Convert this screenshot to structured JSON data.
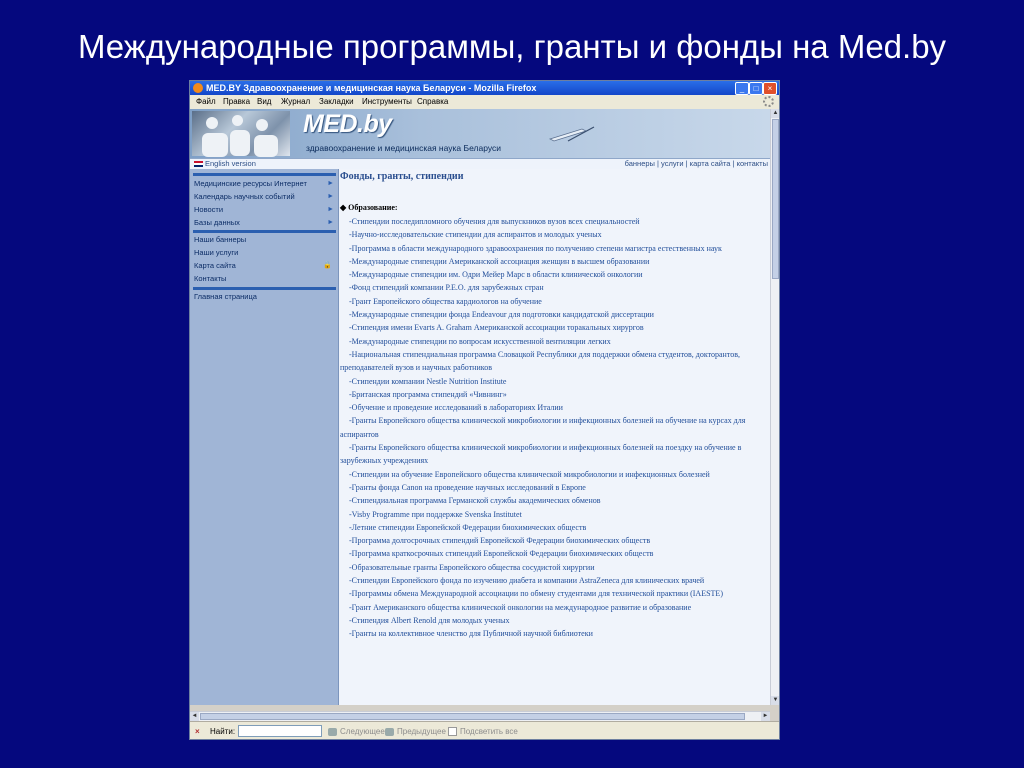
{
  "slide": {
    "title": "Международные программы, гранты и фонды на Med.by"
  },
  "window": {
    "title": "MED.BY Здравоохранение и медицинская наука Беларуси - Mozilla Firefox",
    "controls": [
      "_",
      "□",
      "×"
    ]
  },
  "menu": [
    "Файл",
    "Правка",
    "Вид",
    "Журнал",
    "Закладки",
    "Инструменты",
    "Справка"
  ],
  "banner": {
    "logo": "MED.by",
    "subtitle": "здравоохранение и медицинская наука Беларуси"
  },
  "topbar": {
    "english": "English version",
    "links": "баннеры | услуги | карта сайта | контакты"
  },
  "sidebar": {
    "group1": [
      {
        "label": "Медицинские ресурсы Интернет",
        "arrow": "►"
      },
      {
        "label": "Календарь научных событий",
        "arrow": "►"
      },
      {
        "label": "Новости",
        "arrow": "►"
      },
      {
        "label": "Базы данных",
        "arrow": "►"
      }
    ],
    "group2": [
      {
        "label": "Наши баннеры"
      },
      {
        "label": "Наши услуги"
      },
      {
        "label": "Карта сайта",
        "badge": "🔒"
      },
      {
        "label": "Контакты"
      }
    ],
    "group3": [
      {
        "label": "Главная страница"
      }
    ]
  },
  "content": {
    "title": "Фонды, гранты, стипендии",
    "section": "Образование:",
    "items": [
      "-Стипендии последипломного обучения для выпускников вузов всех специальностей",
      "-Научно-исследовательские стипендии для аспирантов и молодых ученых",
      "-Программа в области международного здравоохранения по получению степени магистра естественных наук",
      "-Международные стипендии Американской ассоциация женщин в высшем образовании",
      "-Международные стипендии им. Одри Мейер Марс в области клинической онкологии",
      "-Фонд стипендий компании P.E.O. для зарубежных стран",
      "-Грант Европейского общества кардиологов на обучение",
      "-Международные стипендии фонда Endeavour для подготовки кандидатской диссертации",
      "-Стипендия имени Evarts A. Graham Американской ассоциации торакальных хирургов",
      "-Международные стипендии по вопросам искусственной вентиляции легких",
      "-Национальная стипендиальная программа Словацкой Республики для поддержки обмена студентов, докторантов, преподавателей вузов и научных работников",
      "-Стипендии компании Nestle Nutrition Institute",
      "-Британская программа стипендий «Чивнинг»",
      "-Обучение и проведение исследований в лабораториях Италии",
      "-Гранты Европейского общества клинической микробиологии и инфекционных болезней на обучение на курсах для аспирантов",
      "-Гранты Европейского общества клинической микробиологии и инфекционных болезней на поездку на обучение в зарубежных учреждениях",
      "-Стипендии на обучение Европейского общества клинической микробиологии и инфекционных болезней",
      "-Гранты фонда Canon на проведение научных исследований в Европе",
      "-Стипендиальная программа Германской службы академических обменов",
      "-Visby Programme при поддержке Svenska Institutet",
      "-Летние стипендии Европейской Федерации биохимических обществ",
      "-Программа долгосрочных стипендий Европейской Федерации биохимических обществ",
      "-Программа краткосрочных стипендий Европейской Федерации биохимических обществ",
      "-Образовательные гранты Европейского общества сосудистой хирургии",
      "-Стипендии Европейского фонда по изучению диабета и компании AstraZeneca для клинических врачей",
      "-Программы обмена Международной ассоциации по обмену студентами для технической практики (IAESTE)",
      "-Грант Американского общества клинической онкологии на международное развитие и образование",
      "-Стипендия Albert Renold для молодых ученых",
      "-Гранты на коллективное членство для Публичной научной библиотеки"
    ]
  },
  "findbar": {
    "close": "×",
    "label": "Найти:",
    "input_value": "",
    "next": "Следующее",
    "prev": "Предыдущее",
    "highlight": "Подсветить все"
  }
}
